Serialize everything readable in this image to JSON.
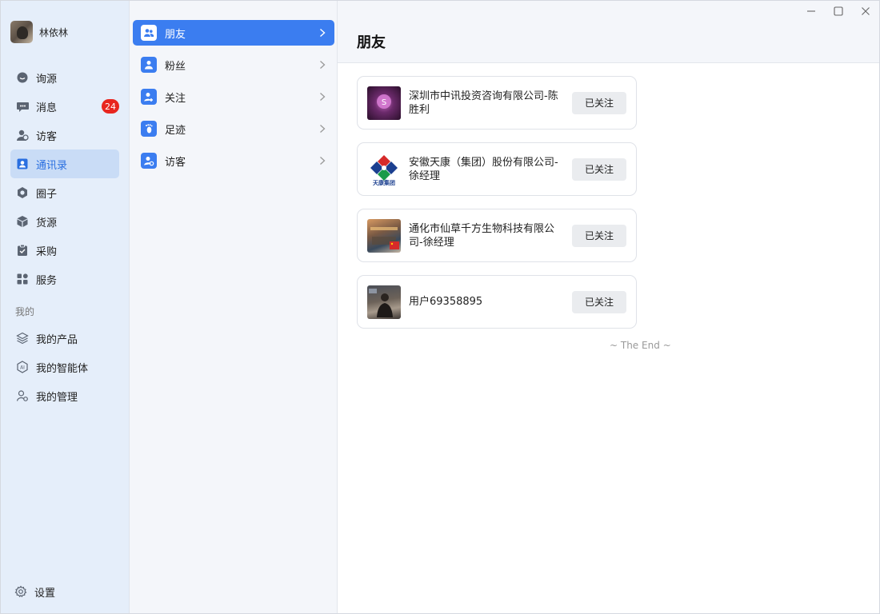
{
  "profile": {
    "name": "林依林"
  },
  "nav": {
    "items": [
      {
        "label": "询源",
        "icon": "chat-bubble-icon"
      },
      {
        "label": "消息",
        "icon": "message-icon",
        "badge": "24"
      },
      {
        "label": "访客",
        "icon": "visitor-icon"
      },
      {
        "label": "通讯录",
        "icon": "contacts-icon",
        "active": true
      },
      {
        "label": "圈子",
        "icon": "circle-icon"
      },
      {
        "label": "货源",
        "icon": "box-icon"
      },
      {
        "label": "采购",
        "icon": "purchase-icon"
      },
      {
        "label": "服务",
        "icon": "grid-icon"
      }
    ],
    "section_label": "我的",
    "my_items": [
      {
        "label": "我的产品",
        "icon": "layers-icon"
      },
      {
        "label": "我的智能体",
        "icon": "ai-icon"
      },
      {
        "label": "我的管理",
        "icon": "user-gear-icon"
      }
    ],
    "settings_label": "设置"
  },
  "sub": {
    "items": [
      {
        "label": "朋友",
        "active": true
      },
      {
        "label": "粉丝"
      },
      {
        "label": "关注"
      },
      {
        "label": "足迹"
      },
      {
        "label": "访客"
      }
    ]
  },
  "main": {
    "title": "朋友",
    "cards": [
      {
        "name": "深圳市中讯投资咨询有限公司-陈胜利",
        "button": "已关注"
      },
      {
        "name": "安徽天康（集团）股份有限公司-徐经理",
        "button": "已关注",
        "logo_text": "天康集团"
      },
      {
        "name": "通化市仙草千方生物科技有限公司-徐经理",
        "button": "已关注"
      },
      {
        "name": "用户69358895",
        "button": "已关注"
      }
    ],
    "end_text": "~ The End ~"
  },
  "colors": {
    "accent": "#3b7df0",
    "badge": "#e8261f",
    "nav_bg": "#e5eefa"
  }
}
